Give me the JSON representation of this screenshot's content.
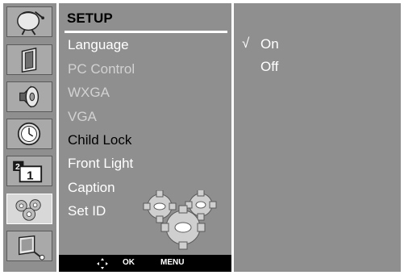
{
  "sidebar": {
    "icons": [
      {
        "name": "picture-icon"
      },
      {
        "name": "screen-icon"
      },
      {
        "name": "audio-icon"
      },
      {
        "name": "timer-icon"
      },
      {
        "name": "input-icon",
        "badge_small": "2",
        "badge_large": "1"
      },
      {
        "name": "setup-icon",
        "active": true
      },
      {
        "name": "special-icon"
      }
    ]
  },
  "menu": {
    "title": "SETUP",
    "items": [
      {
        "label": "Language",
        "state": "normal"
      },
      {
        "label": "PC Control",
        "state": "dim"
      },
      {
        "label": "WXGA",
        "state": "dim"
      },
      {
        "label": "VGA",
        "state": "dim"
      },
      {
        "label": "Child Lock",
        "state": "selected"
      },
      {
        "label": "Front Light",
        "state": "normal"
      },
      {
        "label": "Caption",
        "state": "normal"
      },
      {
        "label": "Set ID",
        "state": "normal"
      }
    ]
  },
  "navbar": {
    "ok_label": "OK",
    "menu_label": "MENU"
  },
  "options": {
    "check_mark": "√",
    "items": [
      "On",
      "Off"
    ],
    "selected": "On"
  }
}
